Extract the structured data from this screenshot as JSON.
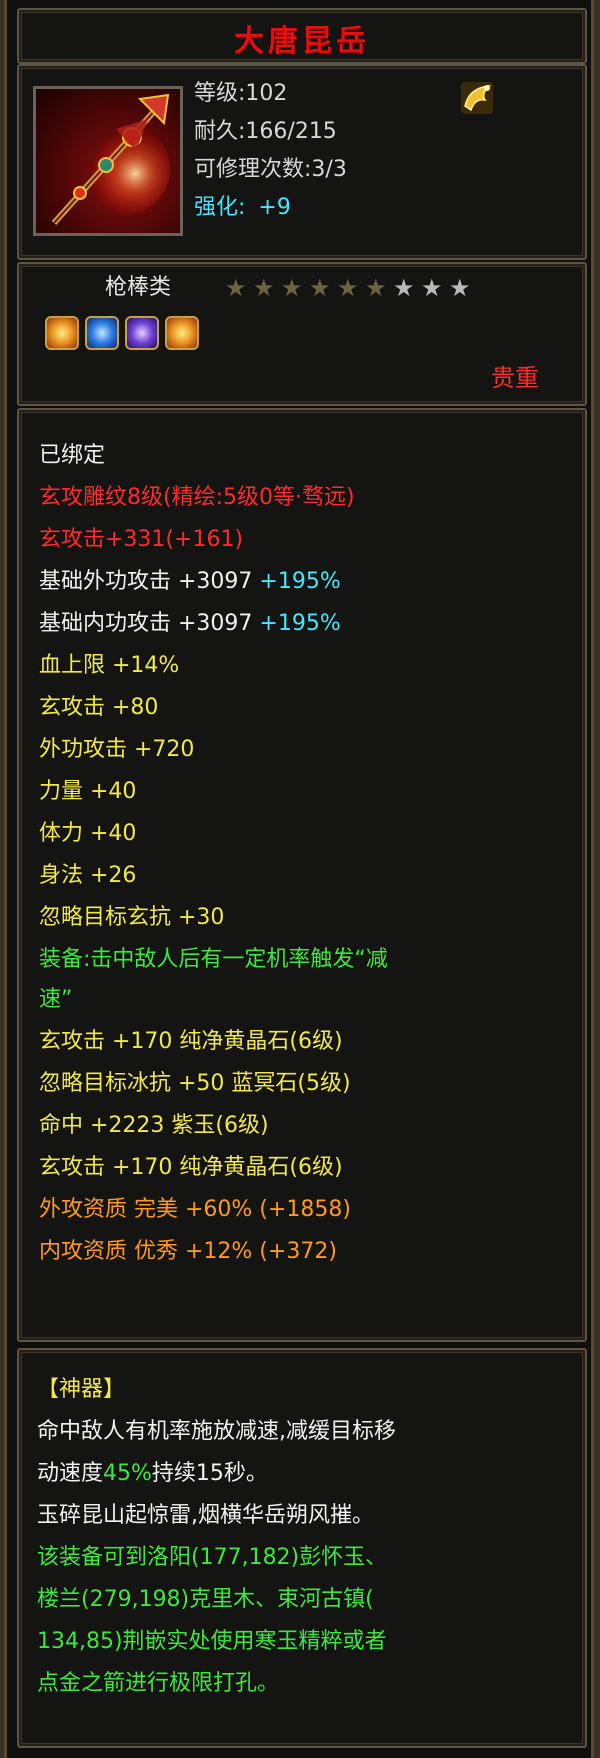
{
  "item": {
    "name": "大唐昆岳",
    "level": "等级:102",
    "durability": "耐久:166/215",
    "repairs": "可修理次数:3/3",
    "enhance_label": "强化:",
    "enhance_value": "+9",
    "category": "枪棒类",
    "stars_total": 9,
    "stars_filled": 6,
    "rarity": "贵重"
  },
  "colors": {
    "title": "#e01010",
    "white": "#f2f2f2",
    "red": "#ff2a2a",
    "cyan": "#45e6ff",
    "yellow": "#f2e84a",
    "green": "#3ce83c",
    "orange": "#ff9a1a"
  },
  "icons": {
    "item": "spear-weapon-icon",
    "badge": "gold-wing-icon",
    "gems": [
      "yellow-crystal-gem-icon",
      "blue-gem-icon",
      "purple-jade-gem-icon",
      "yellow-crystal-gem-icon"
    ]
  },
  "stats": {
    "bound": "已绑定",
    "engrave": "玄攻雕纹8级(精绘:5级0等·骛远)",
    "xuan_atk_total_a": "玄攻击+331",
    "xuan_atk_total_b": "(+161)",
    "base_out_a": "基础外功攻击 +3097",
    "base_out_b": "+195%",
    "base_in_a": "基础内功攻击 +3097",
    "base_in_b": "+195%",
    "hp": "血上限 +14%",
    "xuan_atk": "玄攻击 +80",
    "out_atk": "外功攻击 +720",
    "str": "力量 +40",
    "con": "体力 +40",
    "agi": "身法 +26",
    "ignore": "忽略目标玄抗 +30",
    "equip_effect_1": "装备:击中敌人后有一定机率触发“减",
    "equip_effect_2": "速”",
    "gem1": "玄攻击 +170 纯净黄晶石(6级)",
    "gem2": "忽略目标冰抗 +50 蓝冥石(5级)",
    "gem3": "命中 +2223 紫玉(6级)",
    "gem4": "玄攻击 +170 纯净黄晶石(6级)",
    "apt_out": "外攻资质  完美 +60% (+1858)",
    "apt_in": "内攻资质  优秀 +12% (+372)"
  },
  "artifact": {
    "header": "【神器】",
    "desc_1": "命中敌人有机率施放减速,减缓目标移",
    "desc_2a": "动速度",
    "desc_2b": "45%",
    "desc_2c": "持续15秒。",
    "poem": "玉碎昆山起惊雷,烟横华岳朔风摧。",
    "note_1": "该装备可到洛阳(177,182)彭怀玉、",
    "note_2": "楼兰(279,198)克里木、束河古镇(",
    "note_3": "134,85)荆嵌实处使用寒玉精粹或者",
    "note_4": "点金之箭进行极限打孔。"
  }
}
